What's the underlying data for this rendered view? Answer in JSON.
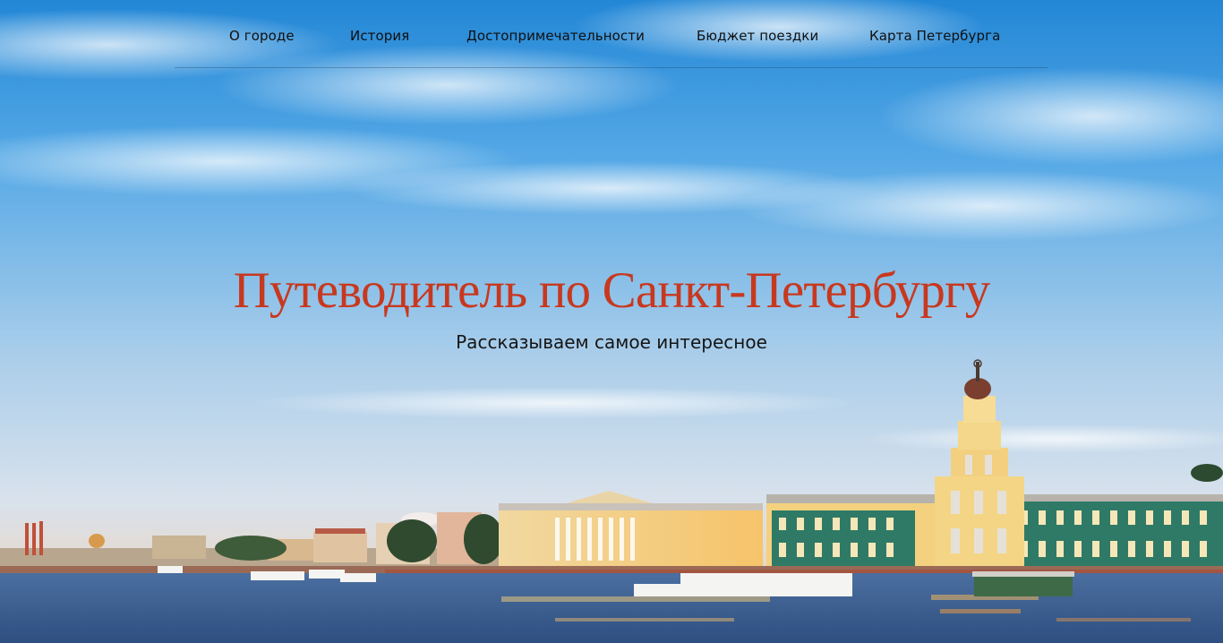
{
  "nav": {
    "items": [
      {
        "label": "О городе"
      },
      {
        "label": "История"
      },
      {
        "label": "Достопримечательности"
      },
      {
        "label": "Бюджет поездки"
      },
      {
        "label": "Карта Петербурга"
      }
    ]
  },
  "hero": {
    "title": "Путеводитель по Санкт-Петербургу",
    "subtitle": "Рассказываем самое интересное"
  },
  "colors": {
    "title": "#c8381e",
    "nav_text": "#101010",
    "sky_top": "#2d8ed8",
    "sky_bottom": "#dfe8f0"
  },
  "image": {
    "description_icon": "st-petersburg-embankment-photo"
  }
}
